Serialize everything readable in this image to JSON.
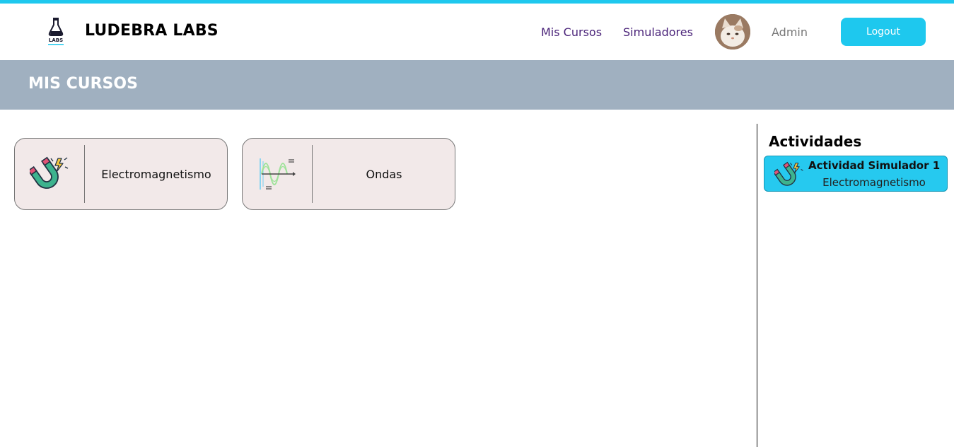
{
  "header": {
    "brand_name": "LUDEBRA LABS",
    "logo_text": "LABS",
    "nav": {
      "mis_cursos": "Mis Cursos",
      "simuladores": "Simuladores"
    },
    "username": "Admin",
    "logout_label": "Logout",
    "accent_color": "#1ec8ee"
  },
  "banner": {
    "title": "MIS CURSOS",
    "color": "#a0b0c0"
  },
  "courses": [
    {
      "label": "Electromagnetismo",
      "icon": "magnet-icon"
    },
    {
      "label": "Ondas",
      "icon": "wave-icon"
    }
  ],
  "sidebar": {
    "title": "Actividades",
    "activities": [
      {
        "title": "Actividad Simulador 1",
        "subtitle": "Electromagnetismo",
        "icon": "magnet-icon"
      }
    ]
  }
}
